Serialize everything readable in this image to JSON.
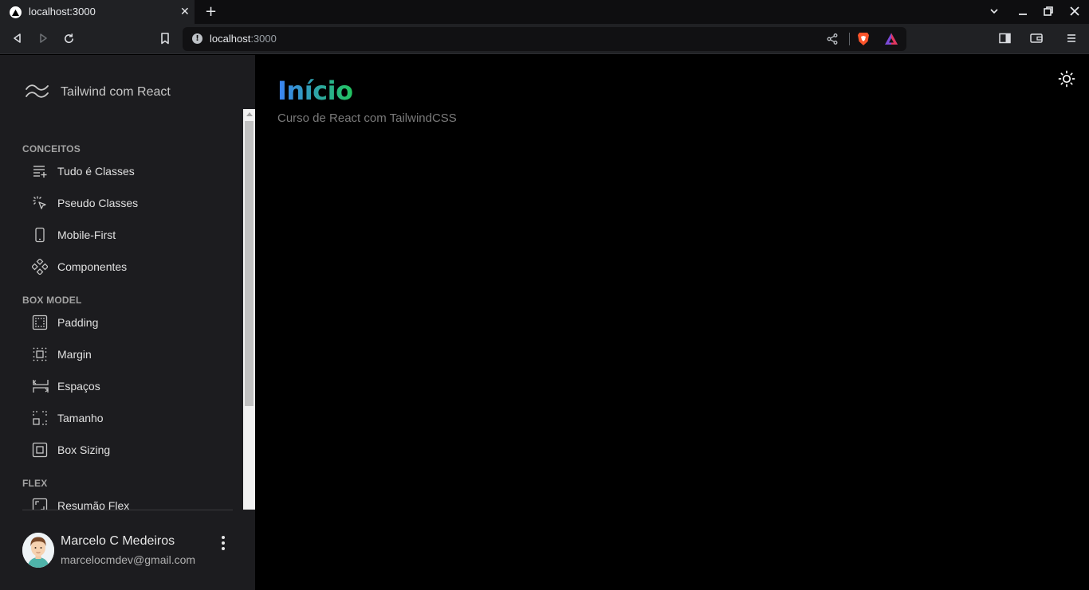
{
  "browser": {
    "tab_title": "localhost:3000",
    "url_host": "localhost",
    "url_port": ":3000"
  },
  "sidebar": {
    "brand": "Tailwind com React",
    "sections": [
      {
        "title": "CONCEITOS",
        "items": [
          {
            "label": "Tudo é Classes",
            "icon": "playlist-add-icon"
          },
          {
            "label": "Pseudo Classes",
            "icon": "cursor-click-icon"
          },
          {
            "label": "Mobile-First",
            "icon": "mobile-phone-icon"
          },
          {
            "label": "Componentes",
            "icon": "components-icon"
          }
        ]
      },
      {
        "title": "BOX MODEL",
        "items": [
          {
            "label": "Padding",
            "icon": "padding-icon"
          },
          {
            "label": "Margin",
            "icon": "margin-icon"
          },
          {
            "label": "Espaços",
            "icon": "spacing-icon"
          },
          {
            "label": "Tamanho",
            "icon": "resize-icon"
          },
          {
            "label": "Box Sizing",
            "icon": "box-sizing-icon"
          }
        ]
      },
      {
        "title": "FLEX",
        "items": [
          {
            "label": "Resumão Flex",
            "icon": "flex-summary-icon"
          }
        ]
      }
    ]
  },
  "profile": {
    "name": "Marcelo C Medeiros",
    "email": "marcelocmdev@gmail.com"
  },
  "main": {
    "title": "Início",
    "subtitle": "Curso de React com TailwindCSS"
  },
  "colors": {
    "sidebar_bg": "#1c1c1f",
    "main_bg": "#000000",
    "title_gradient_start": "#3b82f6",
    "title_gradient_end": "#22c55e"
  }
}
